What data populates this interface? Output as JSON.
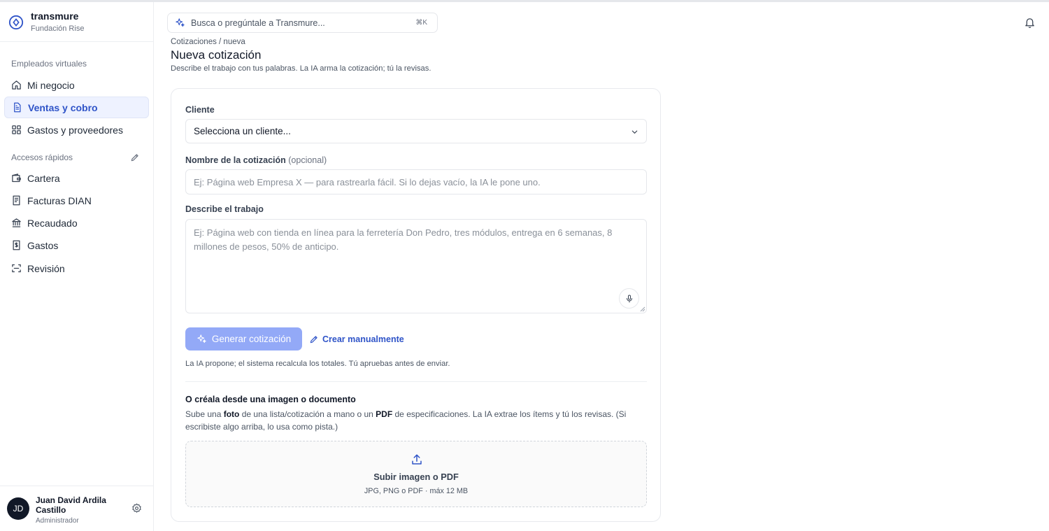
{
  "brand": {
    "name": "transmure",
    "org": "Fundación Rise"
  },
  "sidebar": {
    "section_virtual": "Empleados virtuales",
    "virtual_items": [
      {
        "label": "Mi negocio",
        "icon": "home-icon"
      },
      {
        "label": "Ventas y cobro",
        "icon": "document-icon",
        "active": true
      },
      {
        "label": "Gastos y proveedores",
        "icon": "grid-icon"
      }
    ],
    "section_quick": "Accesos rápidos",
    "quick_items": [
      {
        "label": "Cartera",
        "icon": "wallet-icon"
      },
      {
        "label": "Facturas DIAN",
        "icon": "receipt-icon"
      },
      {
        "label": "Recaudado",
        "icon": "bank-icon"
      },
      {
        "label": "Gastos",
        "icon": "dollar-note-icon"
      },
      {
        "label": "Revisión",
        "icon": "scan-icon"
      }
    ]
  },
  "user": {
    "initials": "JD",
    "name": "Juan David Ardila Castillo",
    "role": "Administrador"
  },
  "search": {
    "placeholder": "Busca o pregúntale a Transmure...",
    "shortcut": "⌘K"
  },
  "header": {
    "breadcrumb": "Cotizaciones / nueva",
    "title": "Nueva cotización",
    "subtitle": "Describe el trabajo con tus palabras. La IA arma la cotización; tú la revisas."
  },
  "form": {
    "client_label": "Cliente",
    "client_value": "Selecciona un cliente...",
    "name_label": "Nombre de la cotización",
    "name_optional": "(opcional)",
    "name_placeholder": "Ej: Página web Empresa X — para rastrearla fácil. Si lo dejas vacío, la IA le pone uno.",
    "work_label": "Describe el trabajo",
    "work_placeholder": "Ej: Página web con tienda en línea para la ferretería Don Pedro, tres módulos, entrega en 6 semanas, 8 millones de pesos, 50% de anticipo.",
    "generate_label": "Generar cotización",
    "manual_label": "Crear manualmente",
    "hint": "La IA propone; el sistema recalcula los totales. Tú apruebas antes de enviar."
  },
  "upload": {
    "title": "O créala desde una imagen o documento",
    "desc_1": "Sube una ",
    "desc_foto": "foto",
    "desc_2": " de una lista/cotización a mano o un ",
    "desc_pdf": "PDF",
    "desc_3": " de especificaciones. La IA extrae los ítems y tú los revisas. (Si escribiste algo arriba, lo usa como pista.)",
    "drop_title": "Subir imagen o PDF",
    "drop_sub": "JPG, PNG o PDF · máx 12 MB"
  },
  "colors": {
    "accent": "#2f54c8",
    "button_disabled": "#93a9f7",
    "active_bg": "#eef2ff"
  }
}
